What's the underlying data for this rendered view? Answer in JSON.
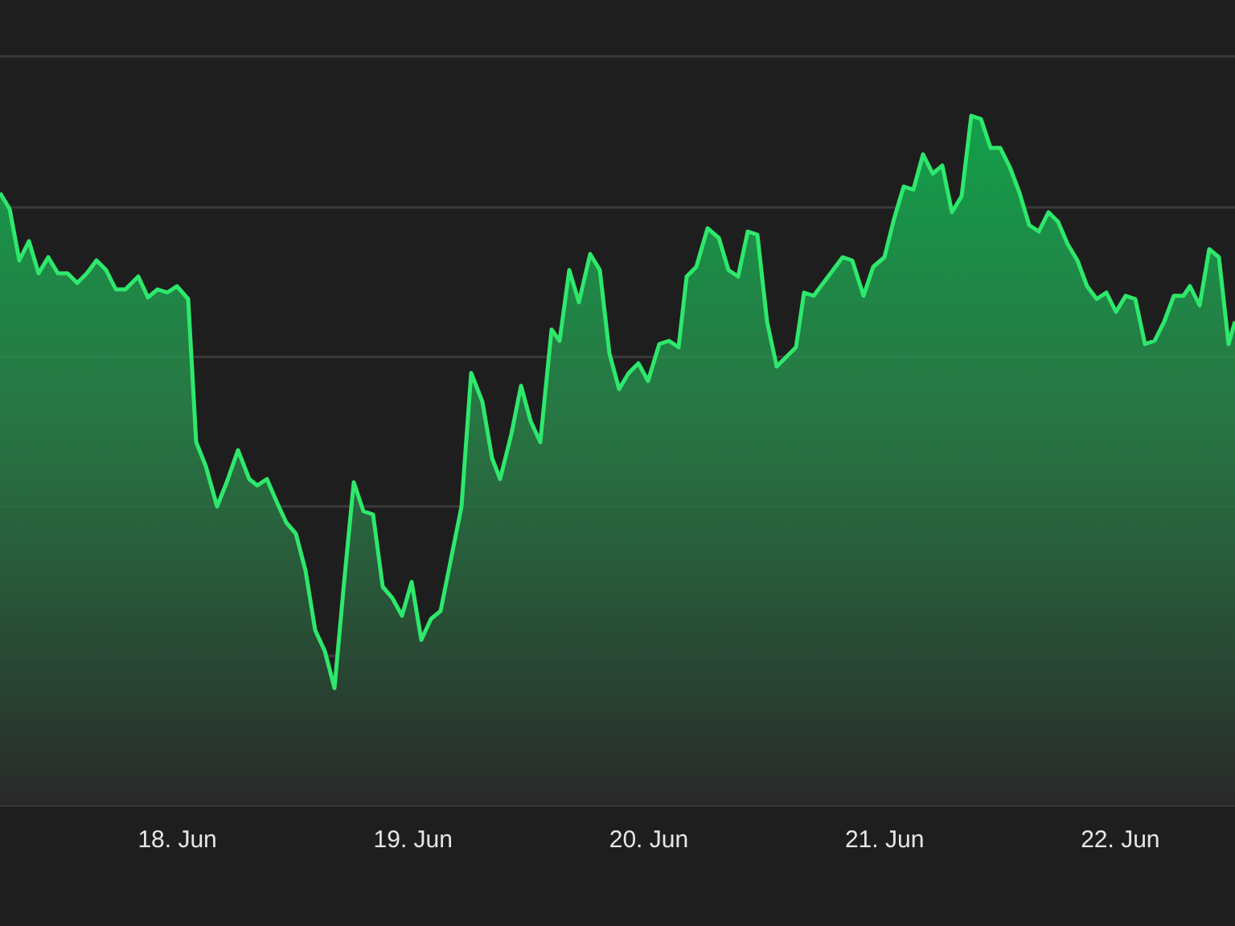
{
  "chart": {
    "x_labels": [
      "18. Jun",
      "19. Jun",
      "20. Jun",
      "21. Jun",
      "22. Jun"
    ]
  }
}
